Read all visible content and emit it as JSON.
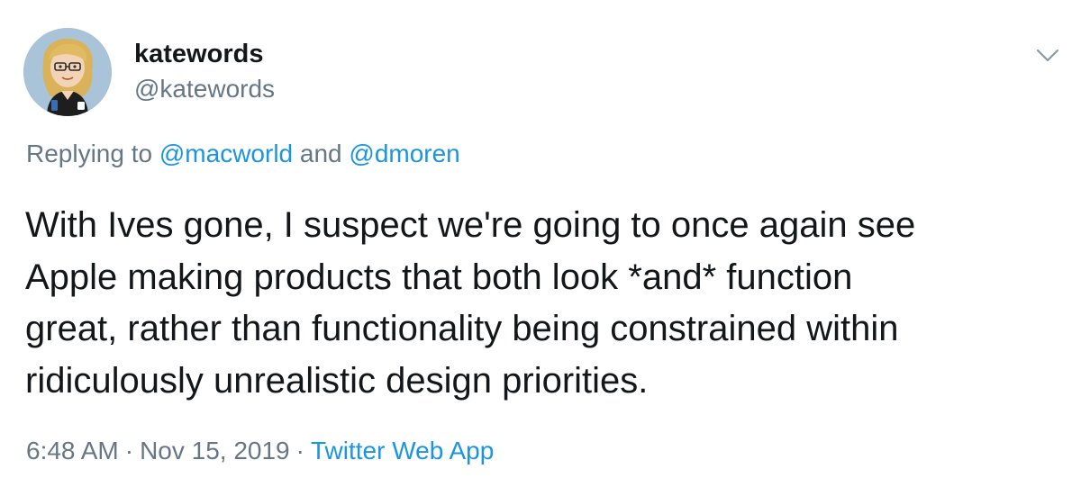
{
  "author": {
    "display_name": "katewords",
    "handle": "@katewords",
    "avatar_icon": "cartoon-avatar-icon"
  },
  "reply": {
    "prefix": "Replying to",
    "mentions": [
      "@macworld",
      "@dmoren"
    ],
    "joiner": "and"
  },
  "tweet": {
    "lines": [
      "With Ives gone, I suspect we're going to once again see",
      "Apple making products that both look *and* function",
      "great, rather than functionality being constrained within",
      "ridiculously unrealistic design priorities."
    ]
  },
  "meta": {
    "time": "6:48 AM",
    "date": "Nov 15, 2019",
    "separator": "·",
    "source": "Twitter Web App"
  },
  "menu": {
    "icon": "chevron-down-icon"
  },
  "colors": {
    "text": "#14171a",
    "secondary": "#657786",
    "link": "#1b95e0"
  }
}
